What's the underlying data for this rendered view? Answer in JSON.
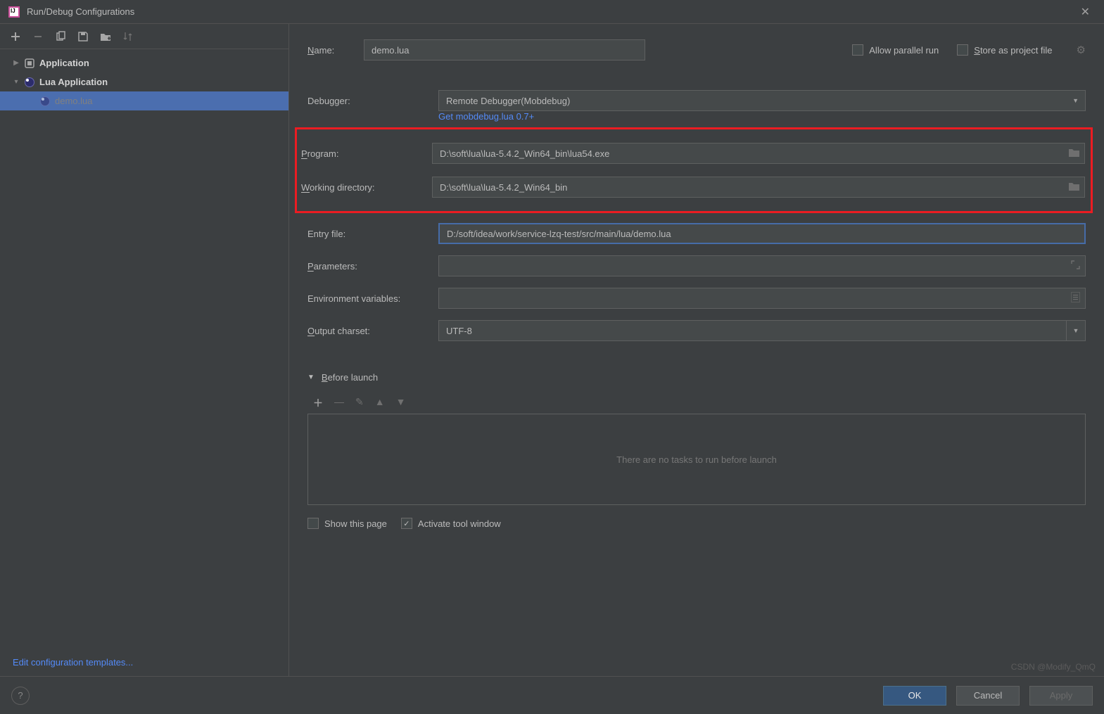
{
  "window": {
    "title": "Run/Debug Configurations"
  },
  "tree": {
    "items": [
      {
        "label": "Application"
      },
      {
        "label": "Lua Application"
      },
      {
        "label": "demo.lua"
      }
    ],
    "edit_templates": "Edit configuration templates..."
  },
  "form": {
    "name_label": "ame:",
    "name_prefix": "N",
    "name_value": "demo.lua",
    "allow_parallel": "Allow parallel run",
    "store_project": "tore as project file",
    "store_prefix": "S",
    "debugger_label": "Debugger:",
    "debugger_value": "Remote Debugger(Mobdebug)",
    "debugger_link": "Get mobdebug.lua 0.7+",
    "program_prefix": "P",
    "program_label": "rogram:",
    "program_value": "D:\\soft\\lua\\lua-5.4.2_Win64_bin\\lua54.exe",
    "workdir_prefix": "W",
    "workdir_label": "orking directory:",
    "workdir_value": "D:\\soft\\lua\\lua-5.4.2_Win64_bin",
    "entry_label": "Entry file:",
    "entry_value": "D:/soft/idea/work/service-lzq-test/src/main/lua/demo.lua",
    "params_prefix": "P",
    "params_label": "arameters:",
    "params_value": "",
    "env_label": "Environment variables:",
    "env_value": "",
    "charset_prefix": "O",
    "charset_label": "utput charset:",
    "charset_value": "UTF-8"
  },
  "before_launch": {
    "title_prefix": "B",
    "title": "efore launch",
    "empty_text": "There are no tasks to run before launch",
    "show_page": "Show this page",
    "activate_tool": "Activate tool window"
  },
  "buttons": {
    "ok": "OK",
    "cancel": "Cancel",
    "apply": "Apply"
  },
  "watermark": "CSDN @Modify_QmQ"
}
